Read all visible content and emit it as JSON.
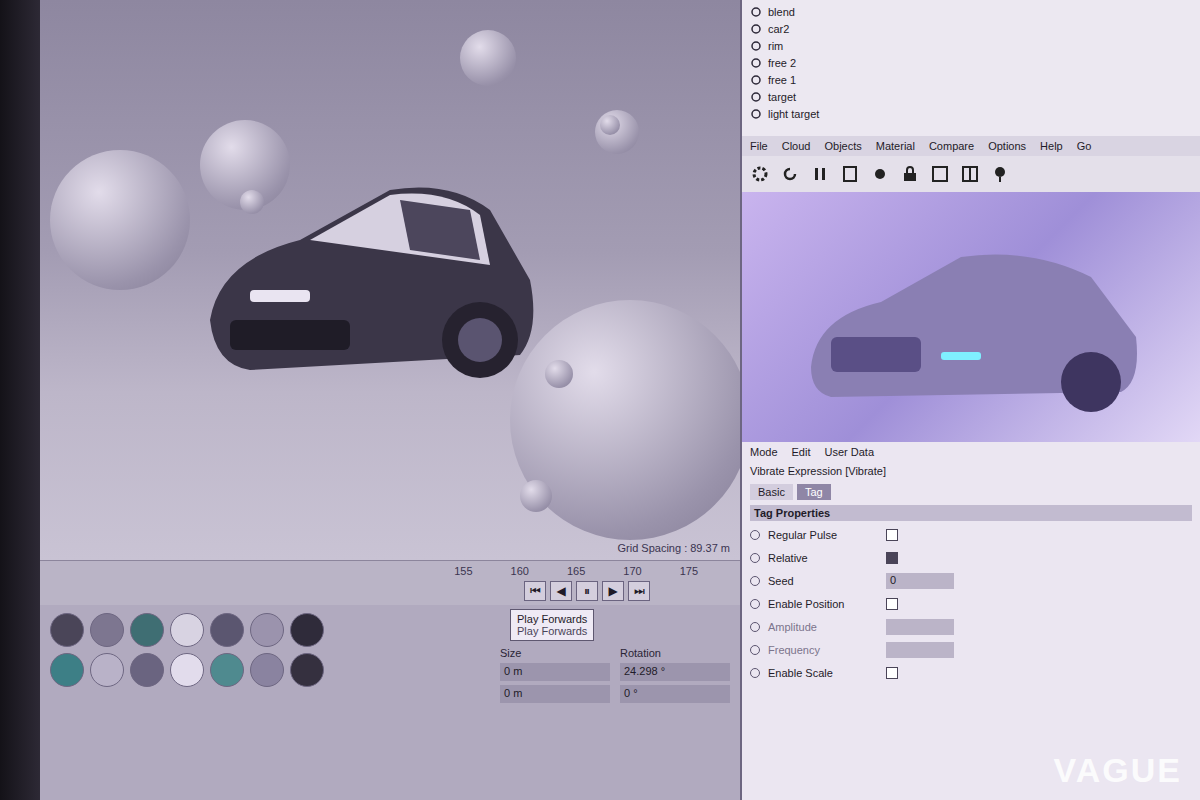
{
  "watermark": "VAGUE",
  "object_manager": {
    "items": [
      {
        "name": "blend",
        "selected": false
      },
      {
        "name": "car2",
        "selected": false
      },
      {
        "name": "rim",
        "selected": false
      },
      {
        "name": "free 2",
        "selected": false
      },
      {
        "name": "free 1",
        "selected": false
      },
      {
        "name": "target",
        "selected": false
      },
      {
        "name": "light target",
        "selected": false
      }
    ]
  },
  "render_view": {
    "menu": [
      "File",
      "Cloud",
      "Objects",
      "Material",
      "Compare",
      "Options",
      "Help",
      "Go"
    ]
  },
  "viewport": {
    "grid_spacing": "Grid Spacing : 89.37 m"
  },
  "timeline": {
    "ticks": [
      "155",
      "160",
      "165",
      "170",
      "175"
    ],
    "transport": [
      "⏮",
      "◀",
      "⏸",
      "▶",
      "⏭"
    ]
  },
  "tooltip": {
    "title": "Play Forwards",
    "hint": "Play Forwards"
  },
  "materials": [
    {
      "color": "#4a4558"
    },
    {
      "color": "#7d7690"
    },
    {
      "color": "#3f6e73"
    },
    {
      "color": "#d8d3e2"
    },
    {
      "color": "#5b5670"
    },
    {
      "color": "#9b93ad"
    },
    {
      "color": "#2f2b3a"
    },
    {
      "color": "#3d7f86"
    },
    {
      "color": "#b9b2c8"
    },
    {
      "color": "#6a6480"
    },
    {
      "color": "#e2dcec"
    },
    {
      "color": "#4f8a8f"
    },
    {
      "color": "#8a83a0"
    },
    {
      "color": "#35303f"
    }
  ],
  "coordinates": {
    "headers": [
      "Size",
      "Rotation"
    ],
    "rows": [
      [
        "0 m",
        "24.298 °"
      ],
      [
        "0 m",
        "0 °"
      ]
    ]
  },
  "attributes": {
    "menu": [
      "Mode",
      "Edit",
      "User Data"
    ],
    "title": "Vibrate Expression [Vibrate]",
    "tabs": [
      {
        "label": "Basic",
        "selected": false
      },
      {
        "label": "Tag",
        "selected": true
      }
    ],
    "section": "Tag Properties",
    "rows": [
      {
        "label": "Regular Pulse",
        "kind": "checkbox",
        "checked": false,
        "disabled": false
      },
      {
        "label": "Relative",
        "kind": "checkbox",
        "checked": true,
        "disabled": false
      },
      {
        "label": "Seed",
        "kind": "field",
        "value": "0",
        "disabled": false
      },
      {
        "label": "Enable Position",
        "kind": "checkbox",
        "checked": false,
        "disabled": false
      },
      {
        "label": "Amplitude",
        "kind": "field",
        "value": "",
        "disabled": true
      },
      {
        "label": "Frequency",
        "kind": "field",
        "value": "",
        "disabled": true
      },
      {
        "label": "Enable Scale",
        "kind": "checkbox",
        "checked": false,
        "disabled": false
      }
    ]
  }
}
